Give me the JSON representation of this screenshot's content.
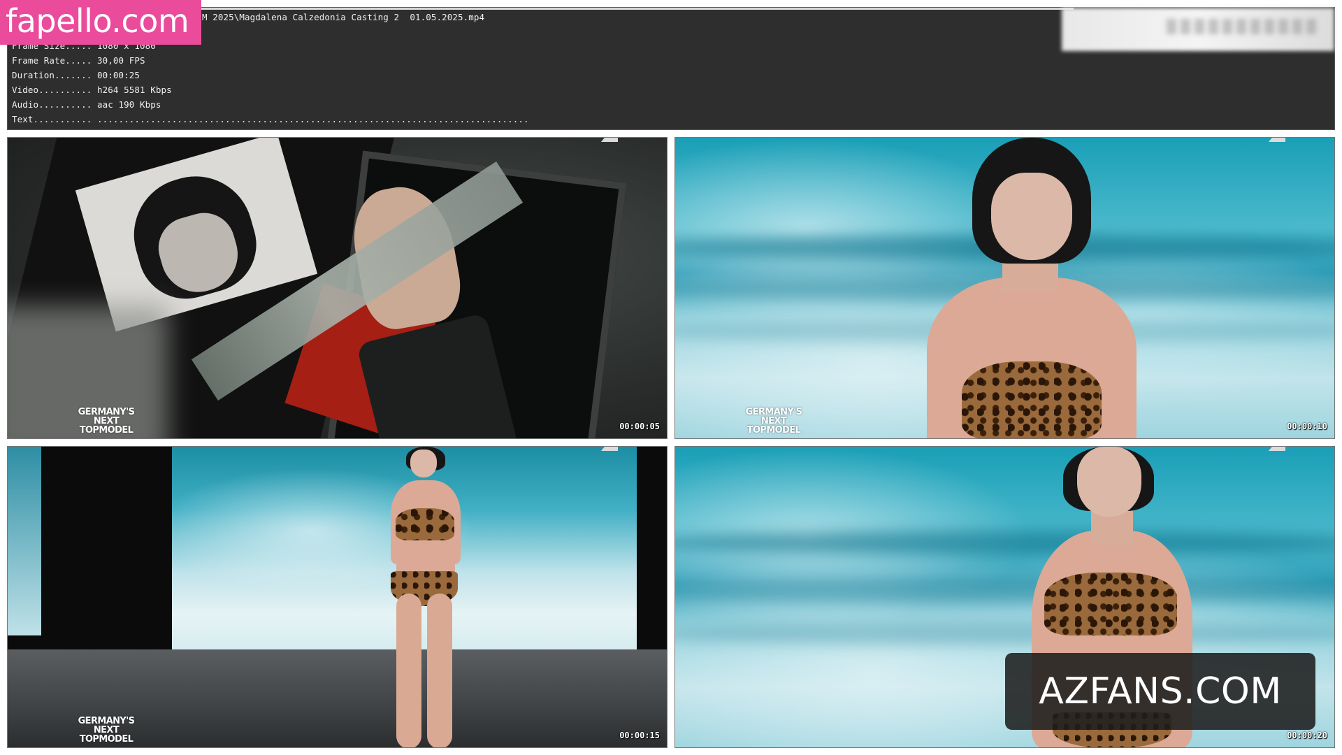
{
  "info": {
    "file_line": "M 2025\\Magdalena Calzedonia Casting 2  01.05.2025.mp4",
    "frame_size": "Frame Size..... 1080 x 1080",
    "frame_rate": "Frame Rate..... 30,00 FPS",
    "duration": "Duration....... 00:00:25",
    "video": "Video.......... h264 5581 Kbps",
    "audio": "Audio.......... aac 190 Kbps",
    "text": "Text........... ................................................................................."
  },
  "watermarks": {
    "top_left": "fapello.com",
    "bottom_right": "AZFANS.COM",
    "top_left_color": "#ea4c9b"
  },
  "thumbnails": [
    {
      "timestamp": "00:00:05",
      "logo": [
        "GERMANY'S",
        "NEXT",
        "TOPMODEL"
      ]
    },
    {
      "timestamp": "00:00:10",
      "logo": [
        "GERMANY'S",
        "NEXT",
        "TOPMODEL"
      ]
    },
    {
      "timestamp": "00:00:15",
      "logo": [
        "GERMANY'S",
        "NEXT",
        "TOPMODEL"
      ]
    },
    {
      "timestamp": "00:00:20",
      "logo": []
    }
  ]
}
